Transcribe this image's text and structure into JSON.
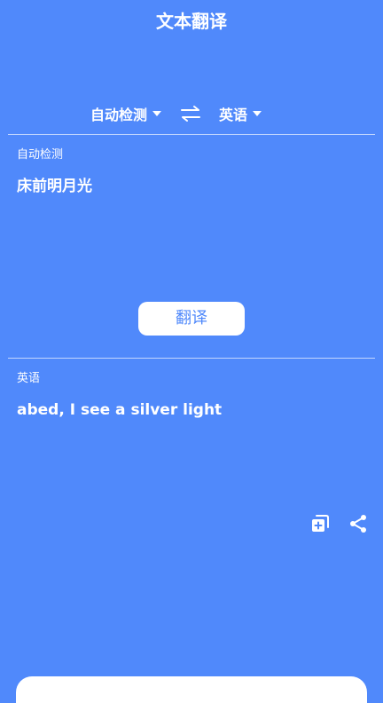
{
  "header": {
    "title": "文本翻译"
  },
  "languages": {
    "source": "自动检测",
    "target": "英语"
  },
  "source_panel": {
    "label": "自动检测",
    "text": "床前明月光"
  },
  "translate_button": {
    "label": "翻译"
  },
  "result_panel": {
    "label": "英语",
    "text": "abed, I see a silver light"
  },
  "icons": {
    "swap": "swap-arrows-icon",
    "copy": "copy-icon",
    "share": "share-icon"
  },
  "colors": {
    "background": "#5089fb",
    "foreground": "#ffffff"
  }
}
